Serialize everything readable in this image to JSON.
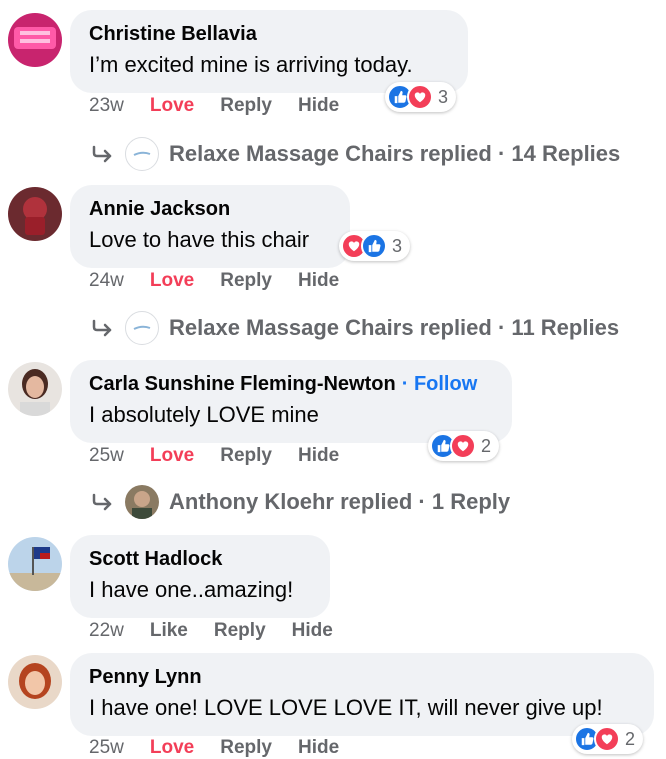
{
  "comments": [
    {
      "author": "Christine Bellavia",
      "text": "I’m excited mine is arriving today.",
      "time": "23w",
      "love_label": "Love",
      "reply_label": "Reply",
      "hide_label": "Hide",
      "reaction_count": "3",
      "replies": {
        "name": "Relaxe Massage Chairs",
        "verb": "replied",
        "sep": "·",
        "count": "14 Replies"
      }
    },
    {
      "author": "Annie Jackson",
      "text": "Love to have this chair",
      "time": "24w",
      "love_label": "Love",
      "reply_label": "Reply",
      "hide_label": "Hide",
      "reaction_count": "3",
      "replies": {
        "name": "Relaxe Massage Chairs",
        "verb": "replied",
        "sep": "·",
        "count": "11 Replies"
      }
    },
    {
      "author": "Carla Sunshine Fleming-Newton",
      "follow_sep": "·",
      "follow_label": "Follow",
      "text": "I absolutely LOVE mine",
      "time": "25w",
      "love_label": "Love",
      "reply_label": "Reply",
      "hide_label": "Hide",
      "reaction_count": "2",
      "replies": {
        "name": "Anthony Kloehr",
        "verb": "replied",
        "sep": "·",
        "count": "1 Reply"
      }
    },
    {
      "author": "Scott Hadlock",
      "text": "I have one..amazing!",
      "time": "22w",
      "like_label": "Like",
      "reply_label": "Reply",
      "hide_label": "Hide"
    },
    {
      "author": "Penny Lynn",
      "text": "I have one! LOVE LOVE LOVE IT, will never give up!",
      "time": "25w",
      "love_label": "Love",
      "reply_label": "Reply",
      "hide_label": "Hide",
      "reaction_count": "2"
    }
  ],
  "colors": {
    "accent": "#1877f2",
    "love": "#f33e58",
    "muted": "#65676b",
    "bubble": "#f0f2f5"
  },
  "icons": {
    "like": "like-icon",
    "heart": "heart-icon",
    "reply": "reply-arrow-icon"
  }
}
